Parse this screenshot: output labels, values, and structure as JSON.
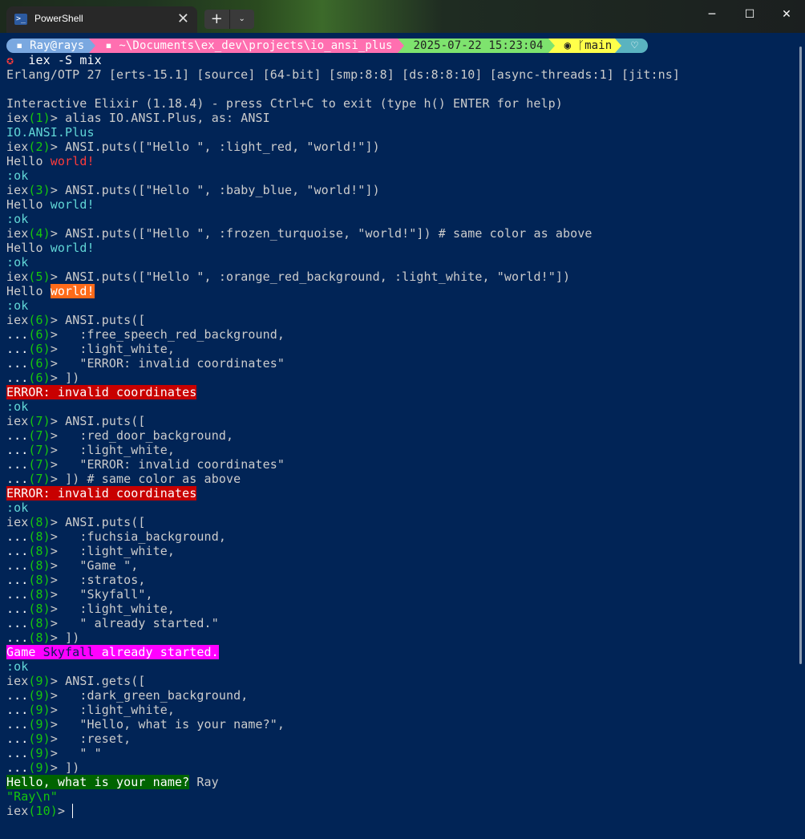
{
  "window": {
    "tab_title": "PowerShell",
    "tab_icon": "powershell-icon",
    "close_tab": "✕",
    "new_tab": "+",
    "dropdown": "⌄",
    "minimize": "─",
    "maximize": "☐",
    "close": "✕"
  },
  "prompt": {
    "user": "Ray@rays",
    "path": "~\\Documents\\ex_dev\\projects\\io_ansi_plus",
    "time": "2025-07-22 15:23:04",
    "branch": "main",
    "heart": "♡",
    "command": "iex -S mix",
    "colors": {
      "user": "#7aa8e0",
      "path": "#ff6fb0",
      "time": "#7ee36e",
      "git": "#ffff4a",
      "heart": "#5ab3c0"
    }
  },
  "session": {
    "otp": "Erlang/OTP 27 [erts-15.1] [source] [64-bit] [smp:8:8] [ds:8:8:10] [async-threads:1] [jit:ns]",
    "banner": "Interactive Elixir (1.18.4) - press Ctrl+C to exit (type h() ENTER for help)",
    "alias_cmd": "alias IO.ANSI.Plus, as: ANSI",
    "alias_out": "IO.ANSI.Plus",
    "c2": "ANSI.puts([\"Hello \", :light_red, \"world!\"])",
    "c3": "ANSI.puts([\"Hello \", :baby_blue, \"world!\"])",
    "c4": "ANSI.puts([\"Hello \", :frozen_turquoise, \"world!\"]) # same color as above",
    "c5": "ANSI.puts([\"Hello \", :orange_red_background, :light_white, \"world!\"])",
    "hello": "Hello ",
    "world": "world!",
    "ok": ":ok",
    "c6": [
      "ANSI.puts([",
      "  :free_speech_red_background,",
      "  :light_white,",
      "  \"ERROR: invalid coordinates\"",
      "])"
    ],
    "err": "ERROR: invalid coordinates",
    "c7": [
      "ANSI.puts([",
      "  :red_door_background,",
      "  :light_white,",
      "  \"ERROR: invalid coordinates\"",
      "]) # same color as above"
    ],
    "c8": [
      "ANSI.puts([",
      "  :fuchsia_background,",
      "  :light_white,",
      "  \"Game \",",
      "  :stratos,",
      "  \"Skyfall\",",
      "  :light_white,",
      "  \" already started.\"",
      "])"
    ],
    "game1": "Game ",
    "game2": "Skyfall",
    "game3": " already started.",
    "c9": [
      "ANSI.gets([",
      "  :dark_green_background,",
      "  :light_white,",
      "  \"Hello, what is your name?\",",
      "  :reset,",
      "  \" \"",
      "])"
    ],
    "q": "Hello, what is your name?",
    "answer": " Ray",
    "ret": "\"Ray\\n\"",
    "last_prompt": "iex(10)> "
  }
}
